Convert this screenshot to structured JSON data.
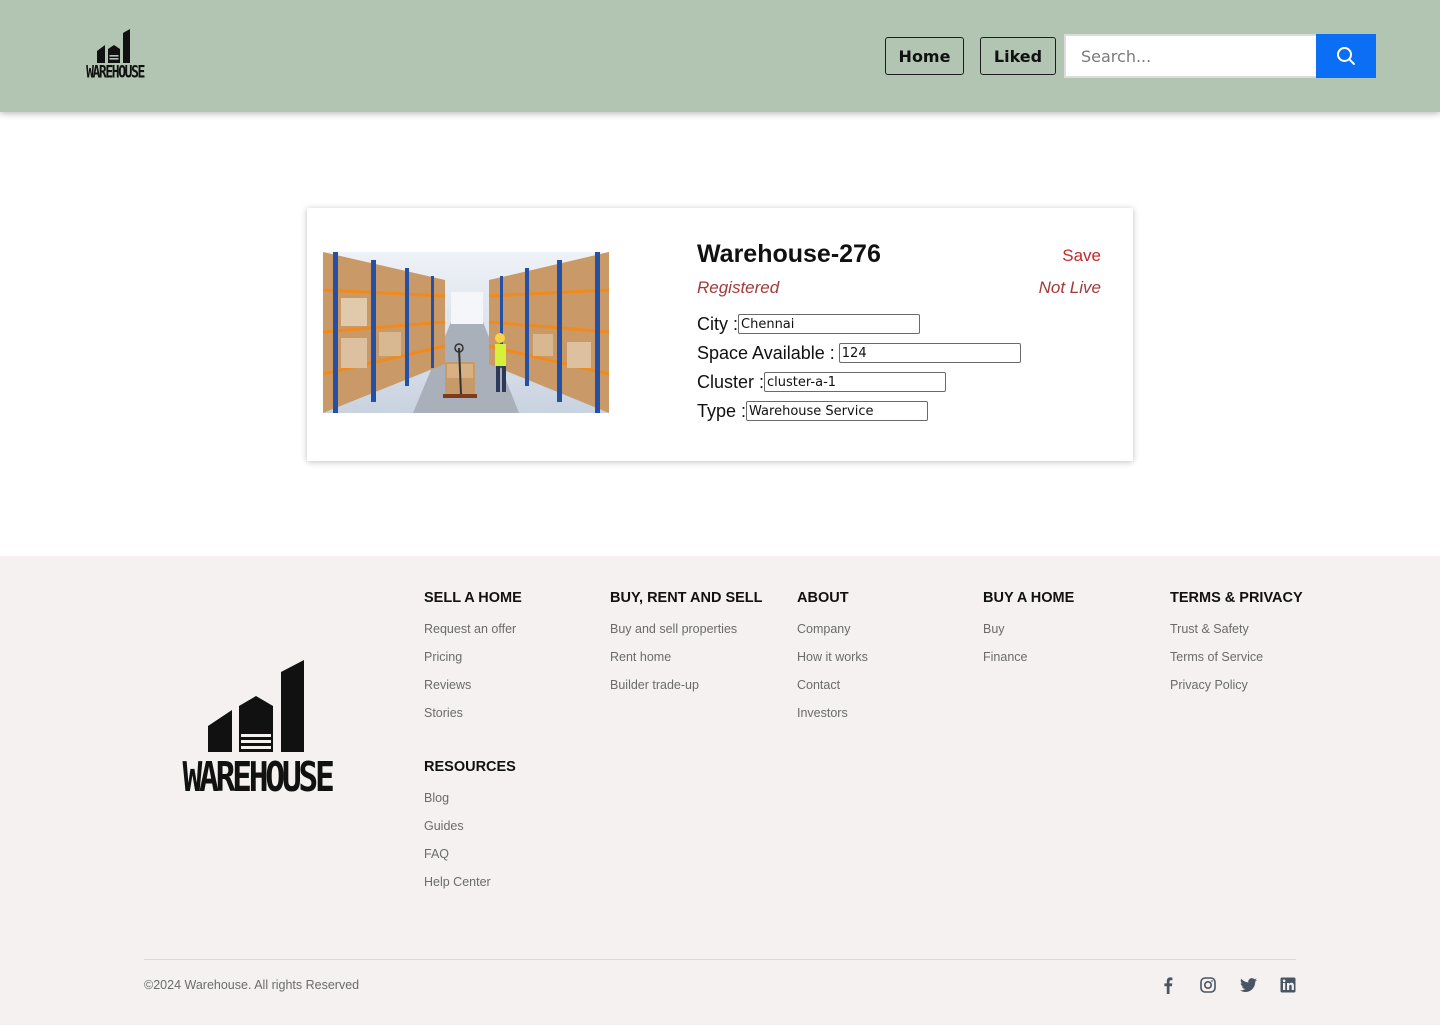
{
  "header": {
    "logo_text": "WAREHOUSE",
    "nav": {
      "home_label": "Home",
      "liked_label": "Liked"
    },
    "search": {
      "placeholder": "Search...",
      "value": "",
      "button_icon": "search-icon"
    },
    "background": "#b2c4b2",
    "accent": "#0b6ff6"
  },
  "listing": {
    "title": "Warehouse-276",
    "save_label": "Save",
    "status": "Registered",
    "live_status": "Not Live",
    "fields": {
      "city_label": "City :",
      "city_value": "Chennai",
      "space_label": "Space Available :",
      "space_value": "124",
      "cluster_label": "Cluster :",
      "cluster_value": "cluster-a-1",
      "type_label": "Type :",
      "type_value": "Warehouse Service"
    },
    "image": "warehouse-interior-photo",
    "accent_red": "#c0282a"
  },
  "footer": {
    "logo_text": "WAREHOUSE",
    "columns": [
      {
        "title": "SELL A HOME",
        "links": [
          "Request an offer",
          "Pricing",
          "Reviews",
          "Stories"
        ]
      },
      {
        "title": "BUY, RENT AND SELL",
        "links": [
          "Buy and sell properties",
          "Rent home",
          "Builder trade-up"
        ]
      },
      {
        "title": "ABOUT",
        "links": [
          "Company",
          "How it works",
          "Contact",
          "Investors"
        ]
      },
      {
        "title": "BUY A HOME",
        "links": [
          "Buy",
          "Finance"
        ]
      },
      {
        "title": "TERMS & PRIVACY",
        "links": [
          "Trust & Safety",
          "Terms of Service",
          "Privacy Policy"
        ]
      },
      {
        "title": "RESOURCES",
        "links": [
          "Blog",
          "Guides",
          "FAQ",
          "Help Center"
        ]
      }
    ],
    "copyright": "©2024 Warehouse. All rights Reserved",
    "social_icons": [
      "facebook-icon",
      "instagram-icon",
      "twitter-icon",
      "linkedin-icon"
    ],
    "background": "#f4f1f0"
  }
}
